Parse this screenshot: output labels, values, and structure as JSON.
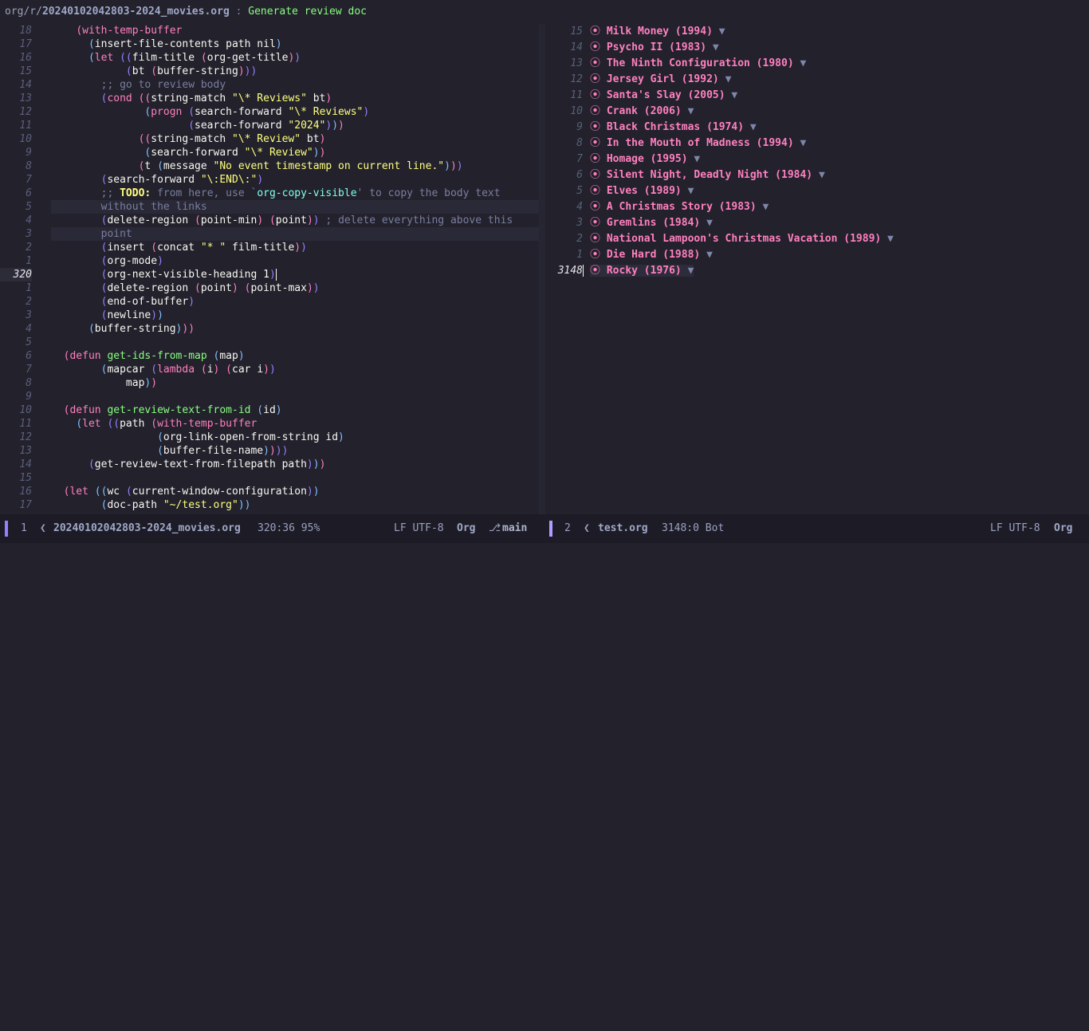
{
  "header": {
    "dir": "org/r/",
    "file": "20240102042803-2024_movies.org",
    "separator": " : ",
    "title": "Generate review doc"
  },
  "left_pane": {
    "lines": [
      {
        "n": "18",
        "indent": "    ",
        "tokens": [
          [
            "p1",
            "("
          ],
          [
            "kw",
            "with-temp-buffer"
          ]
        ]
      },
      {
        "n": "17",
        "indent": "      ",
        "tokens": [
          [
            "p2",
            "("
          ],
          [
            "",
            "insert-file-contents path nil"
          ],
          [
            "p2",
            ")"
          ]
        ]
      },
      {
        "n": "16",
        "indent": "      ",
        "tokens": [
          [
            "p2",
            "("
          ],
          [
            "kw",
            "let"
          ],
          [
            "",
            ""
          ],
          [
            "p3",
            " (("
          ],
          [
            "",
            "film-title "
          ],
          [
            "p1",
            "("
          ],
          [
            "",
            "org-get-title"
          ],
          [
            "p1",
            ")"
          ],
          [
            "p3",
            ")"
          ]
        ]
      },
      {
        "n": "15",
        "indent": "            ",
        "tokens": [
          [
            "p3",
            "("
          ],
          [
            "",
            "bt "
          ],
          [
            "p1",
            "("
          ],
          [
            "",
            "buffer-string"
          ],
          [
            "p1",
            ")"
          ],
          [
            "p3",
            "))"
          ]
        ]
      },
      {
        "n": "14",
        "indent": "        ",
        "tokens": [
          [
            "cm",
            ";; go to review body"
          ]
        ]
      },
      {
        "n": "13",
        "indent": "        ",
        "tokens": [
          [
            "p3",
            "("
          ],
          [
            "kw",
            "cond"
          ],
          [
            "p1",
            " (("
          ],
          [
            "",
            "string-match "
          ],
          [
            "str",
            "\"\\* Reviews\""
          ],
          [
            "",
            ""
          ],
          [
            "",
            ""
          ],
          [
            "",
            ""
          ],
          [
            "",
            ""
          ],
          [
            "",
            ""
          ],
          [
            "",
            ""
          ],
          [
            "",
            ""
          ],
          [
            "",
            ""
          ],
          [
            "",
            ""
          ],
          [
            "",
            ""
          ],
          [
            "",
            ""
          ],
          [
            "",
            ""
          ],
          [
            "",
            ""
          ],
          [
            "",
            ""
          ],
          [
            "",
            ""
          ],
          [
            "",
            ""
          ],
          [
            "",
            ""
          ],
          [
            "",
            ""
          ],
          [
            "",
            ""
          ],
          [
            "",
            ""
          ],
          [
            "",
            ""
          ],
          [
            "",
            ""
          ],
          [
            "",
            ""
          ],
          [
            "",
            ""
          ],
          [
            "",
            ""
          ],
          [
            "",
            ""
          ],
          [
            "",
            ""
          ],
          [
            "",
            ""
          ],
          [
            "",
            ""
          ],
          [
            "",
            ""
          ],
          [
            "",
            ""
          ],
          [
            "",
            ""
          ],
          [
            "",
            ""
          ],
          [
            "",
            ""
          ],
          [
            "",
            ""
          ],
          [
            "",
            ""
          ],
          [
            "",
            ""
          ],
          [
            "",
            ""
          ],
          [
            "",
            ""
          ],
          [
            "",
            ""
          ],
          [
            "",
            ""
          ],
          [
            "",
            ""
          ],
          [
            "",
            ""
          ],
          [
            "",
            ""
          ],
          [
            "",
            ""
          ],
          [
            "",
            ""
          ],
          [
            "",
            ""
          ],
          [
            "",
            ""
          ],
          [
            "",
            ""
          ],
          [
            "",
            ""
          ],
          [
            "",
            ""
          ],
          [
            "",
            ""
          ],
          [
            "",
            ""
          ],
          [
            "",
            ""
          ],
          [
            "",
            ""
          ],
          [
            "",
            ""
          ],
          [
            "",
            ""
          ],
          [
            "",
            ""
          ],
          [
            "",
            ""
          ],
          [
            "",
            ""
          ],
          [
            "",
            ""
          ],
          [
            "",
            " bt"
          ],
          [
            "p1",
            ")"
          ]
        ]
      },
      {
        "n": "12",
        "indent": "               ",
        "tokens": [
          [
            "p2",
            "("
          ],
          [
            "kw",
            "progn"
          ],
          [
            "p3",
            " ("
          ],
          [
            "",
            "search-forward "
          ],
          [
            "str",
            "\"\\* Reviews\""
          ],
          [
            "p3",
            ")"
          ]
        ]
      },
      {
        "n": "11",
        "indent": "                      ",
        "tokens": [
          [
            "p3",
            "("
          ],
          [
            "",
            "search-forward "
          ],
          [
            "str",
            "\"2024\""
          ],
          [
            "p3",
            ")"
          ],
          [
            "p2",
            ")"
          ],
          [
            "p1",
            ")"
          ]
        ]
      },
      {
        "n": "10",
        "indent": "              ",
        "tokens": [
          [
            "p1",
            "(("
          ],
          [
            "",
            "string-match "
          ],
          [
            "str",
            "\"\\* Review\""
          ],
          [
            "",
            " bt"
          ],
          [
            "p1",
            ")"
          ]
        ]
      },
      {
        "n": "9",
        "indent": "               ",
        "tokens": [
          [
            "p2",
            "("
          ],
          [
            "",
            "search-forward "
          ],
          [
            "str",
            "\"\\* Review\""
          ],
          [
            "p2",
            ")"
          ],
          [
            "p1",
            ")"
          ]
        ]
      },
      {
        "n": "8",
        "indent": "              ",
        "tokens": [
          [
            "p1",
            "("
          ],
          [
            "",
            "t "
          ],
          [
            "p2",
            "("
          ],
          [
            "",
            "message "
          ],
          [
            "str",
            "\"No event timestamp on current line.\""
          ],
          [
            "p2",
            ")"
          ],
          [
            "p1",
            ")"
          ],
          [
            "p3",
            ")"
          ]
        ]
      },
      {
        "n": "7",
        "indent": "        ",
        "tokens": [
          [
            "p3",
            "("
          ],
          [
            "",
            "search-forward "
          ],
          [
            "str",
            "\"\\:END\\:\""
          ],
          [
            "p3",
            ")"
          ]
        ]
      },
      {
        "n": "6",
        "indent": "        ",
        "tokens": [
          [
            "cm",
            ";; "
          ],
          [
            "todo",
            "TODO:"
          ],
          [
            "cm",
            " from here, use `"
          ],
          [
            "sym",
            "org-copy-visible"
          ],
          [
            "cm",
            "' to copy the body text"
          ]
        ]
      },
      {
        "n": "5",
        "indent": "        ",
        "hl": true,
        "tokens": [
          [
            "cm",
            "without the links"
          ]
        ]
      },
      {
        "n": "4",
        "indent": "        ",
        "tokens": [
          [
            "p3",
            "("
          ],
          [
            "",
            "delete-region "
          ],
          [
            "p1",
            "("
          ],
          [
            "",
            "point-min"
          ],
          [
            "p1",
            ")"
          ],
          [
            "",
            ""
          ],
          [
            "p1",
            " ("
          ],
          [
            "",
            "point"
          ],
          [
            "p1",
            ")"
          ],
          [
            "p3",
            ")"
          ],
          [
            "cm",
            " ; delete everything above this"
          ]
        ]
      },
      {
        "n": "3",
        "indent": "        ",
        "hl": true,
        "tokens": [
          [
            "cm",
            "point"
          ]
        ]
      },
      {
        "n": "2",
        "indent": "        ",
        "tokens": [
          [
            "p3",
            "("
          ],
          [
            "",
            "insert "
          ],
          [
            "p1",
            "("
          ],
          [
            "",
            "concat "
          ],
          [
            "str",
            "\"* \""
          ],
          [
            "",
            " film-title"
          ],
          [
            "p1",
            ")"
          ],
          [
            "p3",
            ")"
          ]
        ]
      },
      {
        "n": "1",
        "indent": "        ",
        "tokens": [
          [
            "p3",
            "("
          ],
          [
            "",
            "org-mode"
          ],
          [
            "p3",
            ")"
          ]
        ]
      },
      {
        "n": "320",
        "cur": true,
        "indent": "        ",
        "cursor": true,
        "tokens": [
          [
            "p3",
            "("
          ],
          [
            "",
            "org-next-visible-heading 1"
          ],
          [
            "p3",
            ")"
          ]
        ]
      },
      {
        "n": "1",
        "indent": "        ",
        "tokens": [
          [
            "p3",
            "("
          ],
          [
            "",
            "delete-region "
          ],
          [
            "p1",
            "("
          ],
          [
            "",
            "point"
          ],
          [
            "p1",
            ")"
          ],
          [
            "p1",
            " ("
          ],
          [
            "",
            "point-max"
          ],
          [
            "p1",
            ")"
          ],
          [
            "p3",
            ")"
          ]
        ]
      },
      {
        "n": "2",
        "indent": "        ",
        "tokens": [
          [
            "p3",
            "("
          ],
          [
            "",
            "end-of-buffer"
          ],
          [
            "p3",
            ")"
          ]
        ]
      },
      {
        "n": "3",
        "indent": "        ",
        "tokens": [
          [
            "p3",
            "("
          ],
          [
            "",
            "newline"
          ],
          [
            "p3",
            ")"
          ],
          [
            "p2",
            ")"
          ]
        ]
      },
      {
        "n": "4",
        "indent": "      ",
        "tokens": [
          [
            "p2",
            "("
          ],
          [
            "",
            "buffer-string"
          ],
          [
            "p2",
            ")"
          ],
          [
            "p1",
            "))"
          ]
        ]
      },
      {
        "n": "5",
        "indent": "",
        "tokens": []
      },
      {
        "n": "6",
        "indent": "  ",
        "tokens": [
          [
            "p1",
            "("
          ],
          [
            "kw",
            "defun"
          ],
          [
            "",
            " "
          ],
          [
            "fn",
            "get-ids-from-map"
          ],
          [
            "p2",
            " ("
          ],
          [
            "",
            "map"
          ],
          [
            "p2",
            ")"
          ]
        ]
      },
      {
        "n": "7",
        "indent": "        ",
        "tokens": [
          [
            "p2",
            "("
          ],
          [
            "",
            "mapcar "
          ],
          [
            "p3",
            "("
          ],
          [
            "kw",
            "lambda"
          ],
          [
            "p1",
            " ("
          ],
          [
            "",
            "i"
          ],
          [
            "p1",
            ")"
          ],
          [
            "p1",
            " ("
          ],
          [
            "",
            "car i"
          ],
          [
            "p1",
            ")"
          ],
          [
            "p3",
            ")"
          ]
        ]
      },
      {
        "n": "8",
        "indent": "            ",
        "tokens": [
          [
            "",
            "map"
          ],
          [
            "p2",
            ")"
          ],
          [
            "p1",
            ")"
          ]
        ]
      },
      {
        "n": "9",
        "indent": "",
        "tokens": []
      },
      {
        "n": "10",
        "indent": "  ",
        "tokens": [
          [
            "p1",
            "("
          ],
          [
            "kw",
            "defun"
          ],
          [
            "",
            " "
          ],
          [
            "fn",
            "get-review-text-from-id"
          ],
          [
            "p2",
            " ("
          ],
          [
            "",
            "id"
          ],
          [
            "p2",
            ")"
          ]
        ]
      },
      {
        "n": "11",
        "indent": "    ",
        "tokens": [
          [
            "p2",
            "("
          ],
          [
            "kw",
            "let"
          ],
          [
            "p3",
            " (("
          ],
          [
            "",
            "path "
          ],
          [
            "p1",
            "("
          ],
          [
            "kw",
            "with-temp-buffer"
          ]
        ]
      },
      {
        "n": "12",
        "indent": "                 ",
        "tokens": [
          [
            "p2",
            "("
          ],
          [
            "",
            "org-link-open-from-string id"
          ],
          [
            "p2",
            ")"
          ]
        ]
      },
      {
        "n": "13",
        "indent": "                 ",
        "tokens": [
          [
            "p2",
            "("
          ],
          [
            "",
            "buffer-file-name"
          ],
          [
            "p2",
            ")"
          ],
          [
            "p1",
            ")"
          ],
          [
            "p3",
            "))"
          ]
        ]
      },
      {
        "n": "14",
        "indent": "      ",
        "tokens": [
          [
            "p3",
            "("
          ],
          [
            "",
            "get-review-text-from-filepath path"
          ],
          [
            "p3",
            ")"
          ],
          [
            "p2",
            ")"
          ],
          [
            "p1",
            ")"
          ]
        ]
      },
      {
        "n": "15",
        "indent": "",
        "tokens": []
      },
      {
        "n": "16",
        "indent": "  ",
        "tokens": [
          [
            "p1",
            "("
          ],
          [
            "kw",
            "let"
          ],
          [
            "p2",
            " (("
          ],
          [
            "",
            "wc "
          ],
          [
            "p3",
            "("
          ],
          [
            "",
            "current-window-configuration"
          ],
          [
            "p3",
            ")"
          ],
          [
            "p2",
            ")"
          ]
        ]
      },
      {
        "n": "17",
        "indent": "        ",
        "tokens": [
          [
            "p2",
            "("
          ],
          [
            "",
            "doc-path "
          ],
          [
            "str",
            "\"~/test.org\""
          ],
          [
            "p2",
            "))"
          ]
        ]
      }
    ]
  },
  "right_pane": {
    "lines": [
      {
        "n": "15",
        "title": "Milk Money (1994)"
      },
      {
        "n": "14",
        "title": "Psycho II (1983)"
      },
      {
        "n": "13",
        "title": "The Ninth Configuration (1980)"
      },
      {
        "n": "12",
        "title": "Jersey Girl (1992)"
      },
      {
        "n": "11",
        "title": "Santa's Slay (2005)"
      },
      {
        "n": "10",
        "title": "Crank (2006)"
      },
      {
        "n": "9",
        "title": "Black Christmas (1974)"
      },
      {
        "n": "8",
        "title": "In the Mouth of Madness (1994)"
      },
      {
        "n": "7",
        "title": "Homage (1995)"
      },
      {
        "n": "6",
        "title": "Silent Night, Deadly Night (1984)"
      },
      {
        "n": "5",
        "title": "Elves (1989)"
      },
      {
        "n": "4",
        "title": "A Christmas Story (1983)"
      },
      {
        "n": "3",
        "title": "Gremlins (1984)"
      },
      {
        "n": "2",
        "title": "National Lampoon's Christmas Vacation (1989)"
      },
      {
        "n": "1",
        "title": "Die Hard (1988)"
      },
      {
        "n": "3148",
        "title": "Rocky (1976)",
        "cur": true
      }
    ],
    "bullet": "⦿",
    "fold": "▼"
  },
  "mode_line": {
    "left": {
      "window": "1",
      "file": "20240102042803-2024_movies.org",
      "position": "320:36 95%",
      "encoding": "LF UTF-8",
      "mode": "Org",
      "branch": "main"
    },
    "right": {
      "window": "2",
      "file": "test.org",
      "position": "3148:0 Bot",
      "encoding": "LF UTF-8",
      "mode": "Org"
    }
  }
}
